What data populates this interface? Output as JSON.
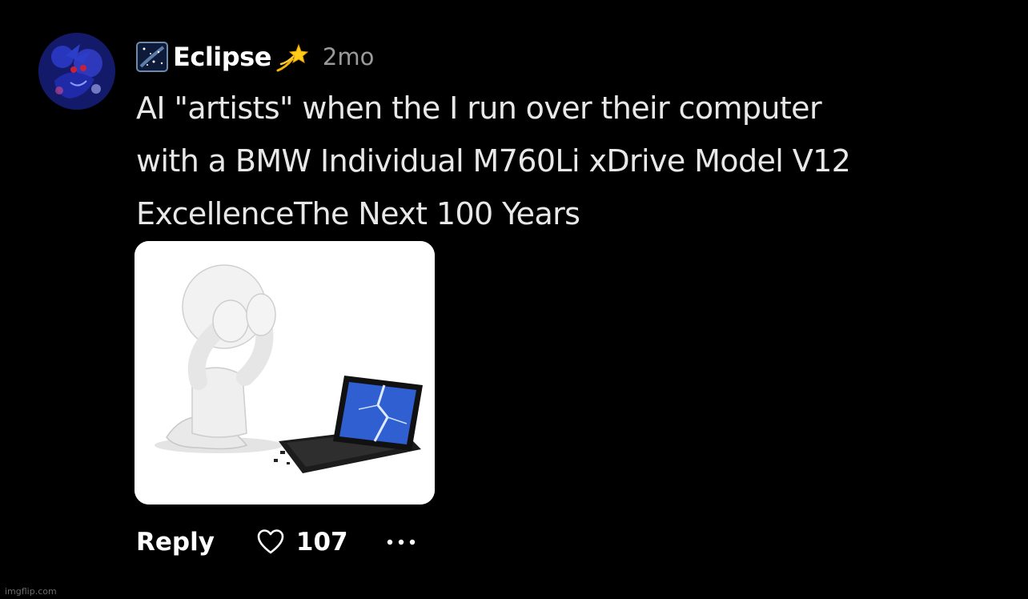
{
  "comment": {
    "author": {
      "name": "Eclipse",
      "name_prefix_icon": "milky-way-icon",
      "name_suffix_icon": "dizzy-icon",
      "avatar_icon": "avatar-image"
    },
    "timestamp": "2mo",
    "text_lines": [
      "AI \"artists\" when the I run over their computer",
      "with a BMW Individual M760Li xDrive Model V12",
      "ExcellenceThe Next 100 Years"
    ],
    "media": {
      "kind": "image",
      "description_icon": "stressed-figure-broken-laptop-image"
    },
    "actions": {
      "reply_label": "Reply",
      "like_icon": "heart-outline-icon",
      "like_count": "107",
      "more_icon": "more-horizontal-icon"
    }
  },
  "watermark": "imgflip.com",
  "colors": {
    "background": "#000000",
    "text": "#e8e8e8",
    "muted": "#9a9a9a",
    "accent": "#ffffff"
  }
}
